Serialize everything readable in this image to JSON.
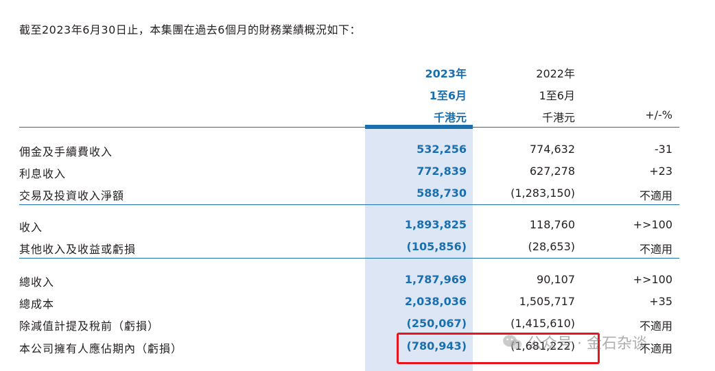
{
  "intro": "截至2023年6月30日止，本集團在過去6個月的財務業績概況如下：",
  "header": {
    "current": [
      "2023年",
      "1至6月",
      "千港元"
    ],
    "previous": [
      "2022年",
      "1至6月",
      "千港元"
    ],
    "change": "+/-%"
  },
  "rows": [
    {
      "label": "佣金及手續費收入",
      "v2023": "532,256",
      "v2022": "774,632",
      "change": "-31"
    },
    {
      "label": "利息收入",
      "v2023": "772,839",
      "v2022": "627,278",
      "change": "+23"
    },
    {
      "label": "交易及投資收入淨額",
      "v2023": "588,730",
      "v2022": "(1,283,150)",
      "change": "不適用"
    },
    {
      "label": "收入",
      "v2023": "1,893,825",
      "v2022": "118,760",
      "change": "+>100"
    },
    {
      "label": "其他收入及收益或虧損",
      "v2023": "(105,856)",
      "v2022": "(28,653)",
      "change": "不適用"
    },
    {
      "label": "總收入",
      "v2023": "1,787,969",
      "v2022": "90,107",
      "change": "+>100"
    },
    {
      "label": "總成本",
      "v2023": "2,038,036",
      "v2022": "1,505,717",
      "change": "+35"
    },
    {
      "label": "除減值計提及稅前（虧損）",
      "v2023": "(250,067)",
      "v2022": "(1,415,610)",
      "change": "不適用"
    },
    {
      "label": "本公司擁有人應佔期內（虧損）",
      "v2023": "(780,943)",
      "v2022": "(1,681,222)",
      "change": "不適用"
    }
  ],
  "watermark": "公众号 · 金石杂谈",
  "colors": {
    "accent": "#1a6fae",
    "highlight": "#dde6f4",
    "annotation": "#e8141b"
  }
}
